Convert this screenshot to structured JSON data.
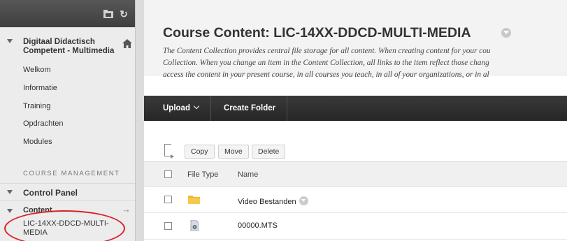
{
  "sidebar": {
    "course_title": "Digitaal Didactisch Competent - Multimedia",
    "nav_items": [
      "Welkom",
      "Informatie",
      "Training",
      "Opdrachten",
      "Modules"
    ],
    "course_management_label": "COURSE MANAGEMENT",
    "control_panel_label": "Control Panel",
    "content_label": "Content",
    "content_sub_item": "LIC-14XX-DDCD-MULTI-MEDIA",
    "icons": {
      "top_left": "folder-tool-icon",
      "top_right": "refresh-icon",
      "course": "home-icon",
      "content_arrow": "right-arrow-icon"
    },
    "annotation_color": "#d8232a"
  },
  "main": {
    "title": "Course Content: LIC-14XX-DDCD-MULTI-MEDIA",
    "description_lines": [
      "The Content Collection provides central file storage for all content. When creating content for your cou",
      "Collection. When you change an item in the Content Collection, all links to the item reflect those chang",
      "access the content in your present course, in all courses you teach, in all of your organizations, or in al"
    ],
    "action_bar": {
      "upload_label": "Upload",
      "create_folder_label": "Create Folder"
    },
    "toolbar": {
      "copy_label": "Copy",
      "move_label": "Move",
      "delete_label": "Delete"
    },
    "table": {
      "headers": {
        "file_type": "File Type",
        "name": "Name"
      },
      "rows": [
        {
          "type_icon": "folder-icon",
          "name": "Video Bestanden",
          "has_menu": true
        },
        {
          "type_icon": "file-icon",
          "name": "00000.MTS",
          "has_menu": false
        }
      ]
    }
  }
}
